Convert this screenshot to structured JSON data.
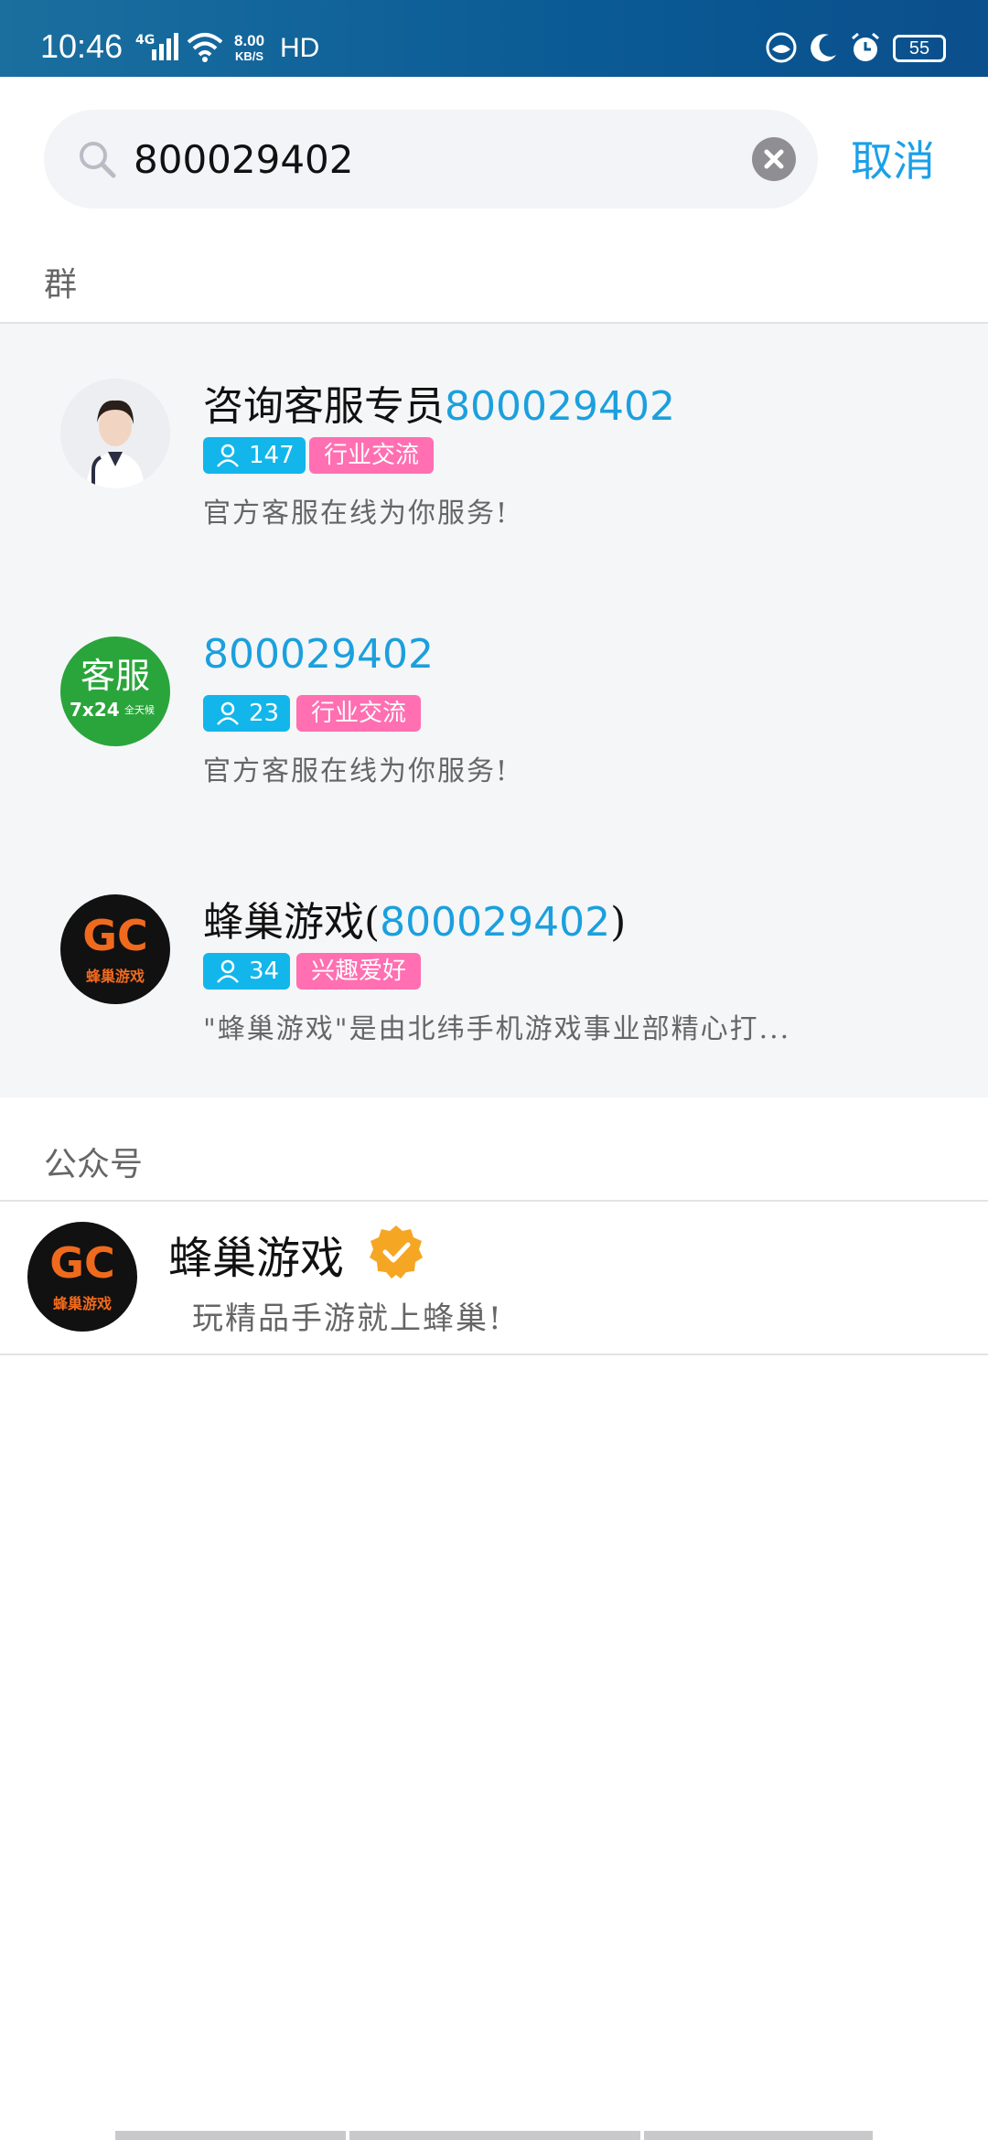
{
  "status_bar": {
    "time": "10:46",
    "network": "4G",
    "speed_value": "8.00",
    "speed_unit": "KB/S",
    "hd": "HD",
    "battery": "55"
  },
  "search": {
    "query": "800029402",
    "placeholder": "",
    "cancel_label": "取消"
  },
  "sections": {
    "groups_label": "群",
    "public_label": "公众号"
  },
  "groups": [
    {
      "title_prefix": "咨询客服专员",
      "title_highlight": "800029402",
      "title_suffix": "",
      "members": "147",
      "category": "行业交流",
      "description": "官方客服在线为你服务!"
    },
    {
      "title_prefix": "",
      "title_highlight": "800029402",
      "title_suffix": "",
      "members": "23",
      "category": "行业交流",
      "description": "官方客服在线为你服务!",
      "avatar_text_main": "客服",
      "avatar_text_sub_a": "7x24",
      "avatar_text_sub_b": "全天候"
    },
    {
      "title_prefix": "蜂巢游戏(",
      "title_highlight": "800029402",
      "title_suffix": ")",
      "members": "34",
      "category": "兴趣爱好",
      "description": "\"蜂巢游戏\"是由北纬手机游戏事业部精心打...",
      "avatar_logo": "GC",
      "avatar_logo_sub": "蜂巢游戏"
    }
  ],
  "public_account": {
    "name": "蜂巢游戏",
    "description": "玩精品手游就上蜂巢!",
    "avatar_logo": "GC",
    "avatar_logo_sub": "蜂巢游戏"
  },
  "colors": {
    "accent": "#1ba0dd",
    "member_tag": "#12b6ea",
    "category_tag": "#ff6fb1",
    "verified": "#f5a623"
  }
}
